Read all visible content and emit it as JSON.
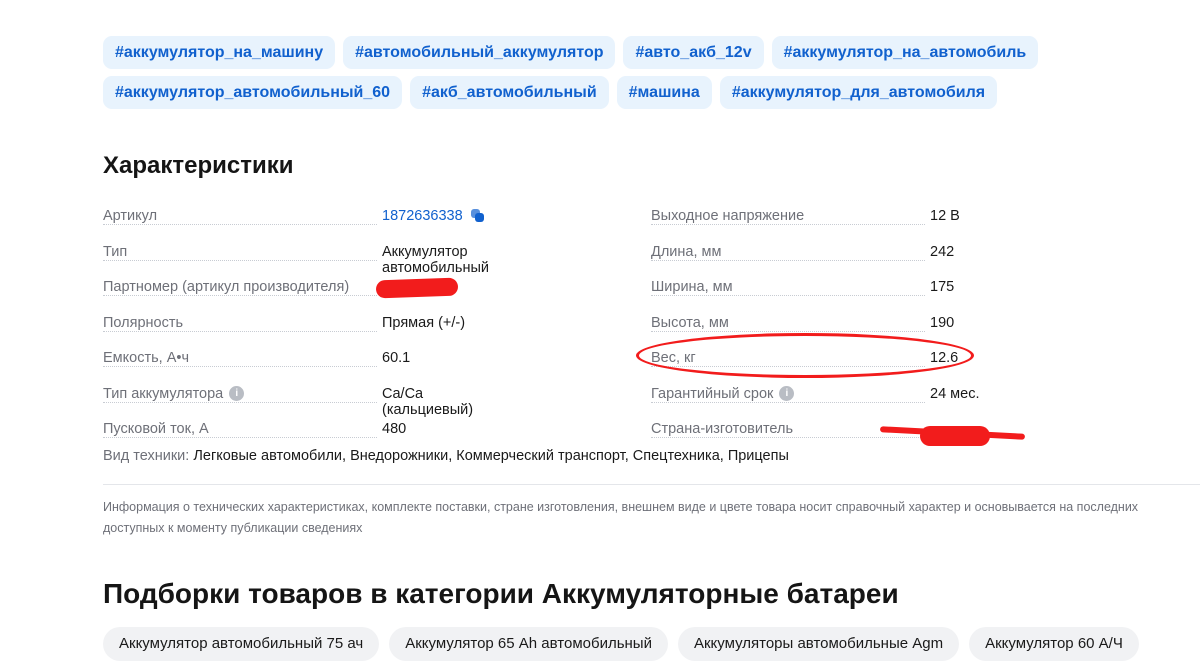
{
  "tags": {
    "row1": [
      "#аккумулятор_на_машину",
      "#автомобильный_аккумулятор",
      "#авто_акб_12v",
      "#аккумулятор_на_автомобиль"
    ],
    "row2": [
      "#аккумулятор_автомобильный_60",
      "#акб_автомобильный",
      "#машина",
      "#аккумулятор_для_автомобиля"
    ]
  },
  "specs": {
    "title": "Характеристики",
    "left": [
      {
        "label": "Артикул",
        "value": "1872636338",
        "icon": "copy-icon"
      },
      {
        "label": "Тип",
        "value": "Аккумулятор автомобильный"
      },
      {
        "label": "Партномер (артикул производителя)",
        "value": ""
      },
      {
        "label": "Полярность",
        "value": "Прямая (+/-)"
      },
      {
        "label": "Емкость, А•ч",
        "value": "60.1"
      },
      {
        "label": "Тип аккумулятора",
        "value": "Ca/Ca (кальциевый)",
        "icon": "info-icon"
      },
      {
        "label": "Пусковой ток, А",
        "value": "480"
      }
    ],
    "right": [
      {
        "label": "Выходное напряжение",
        "value": "12 В"
      },
      {
        "label": "Длина, мм",
        "value": "242"
      },
      {
        "label": "Ширина, мм",
        "value": "175"
      },
      {
        "label": "Высота, мм",
        "value": "190"
      },
      {
        "label": "Вес, кг",
        "value": "12.6"
      },
      {
        "label": "Гарантийный срок",
        "value": "24 мес.",
        "icon": "info-icon"
      },
      {
        "label": "Страна-изготовитель",
        "value": ""
      }
    ],
    "tech_kinds_label": "Вид техники:",
    "tech_kinds_value": "Легковые автомобили, Внедорожники, Коммерческий транспорт, Спецтехника, Прицепы",
    "info_glyph": "i"
  },
  "disclaimer": "Информация о технических характеристиках, комплекте поставки, стране изготовления, внешнем виде и цвете товара носит справочный характер и основывается на последних доступных к моменту публикации сведениях",
  "collections": {
    "title": "Подборки товаров в категории Аккумуляторные батареи",
    "chips": [
      "Аккумулятор автомобильный 75 ач",
      "Аккумулятор 65 Ah автомобильный",
      "Аккумуляторы автомобильные Agm",
      "Аккумулятор 60 А/Ч"
    ]
  },
  "colors": {
    "accent": "#1161ce",
    "tag_bg": "#e8f3fd",
    "annotation_red": "#f21c1c"
  }
}
